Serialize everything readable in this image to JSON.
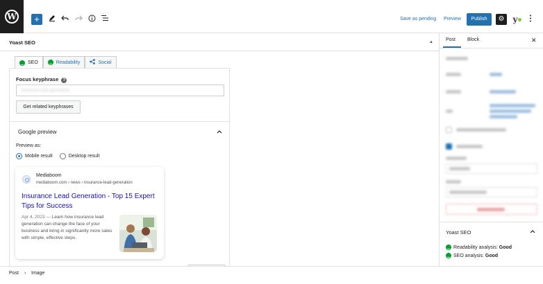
{
  "toolbar": {
    "add_label": "+",
    "save_pending": "Save as pending",
    "preview": "Preview",
    "publish": "Publish"
  },
  "yoast_panel": {
    "title": "Yoast SEO",
    "tabs": [
      {
        "label": "SEO",
        "icon": "smile-icon",
        "active": true
      },
      {
        "label": "Readability",
        "icon": "smile-icon",
        "active": false
      },
      {
        "label": "Social",
        "icon": "share-icon",
        "active": false
      }
    ],
    "focus_keyphrase_label": "Focus keyphrase",
    "focus_keyphrase_value": "insurance lead generation",
    "related_button": "Get related keyphrases",
    "google_preview": {
      "title": "Google preview",
      "preview_as_label": "Preview as:",
      "options": [
        {
          "label": "Mobile result",
          "selected": true
        },
        {
          "label": "Desktop result",
          "selected": false
        }
      ],
      "serp": {
        "site_name": "Mediaboom",
        "url": "mediaboom.com › news › insurance-lead-generation",
        "title": "Insurance Lead Generation - Top 15 Expert Tips for Success",
        "date": "Apr 4, 2023",
        "dash": "—",
        "description": "Learn how insurance lead generation can change the face of your business and bring in significantly more sales with simple, effective steps."
      }
    }
  },
  "sidebar": {
    "tabs": [
      {
        "label": "Post",
        "active": true
      },
      {
        "label": "Block",
        "active": false
      }
    ],
    "yoast": {
      "title": "Yoast SEO",
      "readability_label": "Readability analysis:",
      "readability_value": "Good",
      "seo_label": "SEO analysis:",
      "seo_value": "Good"
    }
  },
  "breadcrumb": {
    "items": [
      "Post",
      "Image"
    ],
    "separator": "›"
  },
  "colors": {
    "accent": "#2271b1",
    "good": "#00a32a",
    "link_title": "#1a0dab"
  }
}
